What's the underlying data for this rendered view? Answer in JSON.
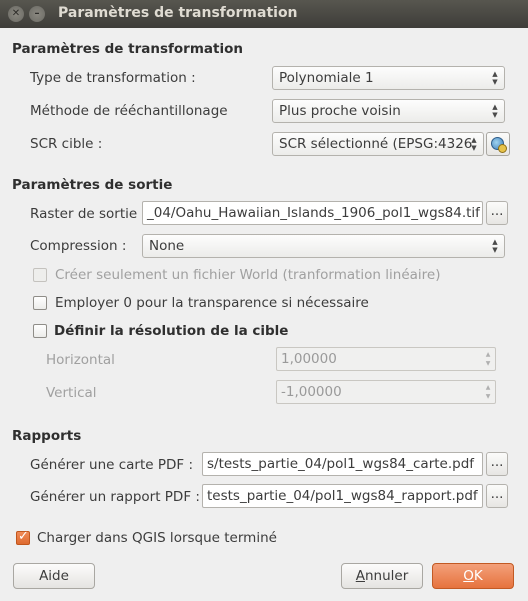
{
  "window": {
    "title": "Paramètres de transformation"
  },
  "transform_section": {
    "title": "Paramètres de transformation",
    "type_label": "Type de transformation :",
    "type_value": "Polynomiale 1",
    "resample_label": "Méthode de rééchantillonage",
    "resample_value": "Plus proche voisin",
    "crs_label": "SCR cible :",
    "crs_value": "SCR sélectionné (EPSG:4326"
  },
  "output_section": {
    "title": "Paramètres de sortie",
    "raster_label": "Raster de sortie",
    "raster_value": "_04/Oahu_Hawaiian_Islands_1906_pol1_wgs84.tif",
    "browse_label": "...",
    "compression_label": "Compression :",
    "compression_value": "None",
    "world_file_label": "Créer seulement un fichier World (tranformation linéaire)",
    "world_file_checked": false,
    "transparency_label": "Employer 0 pour la transparence si nécessaire",
    "transparency_checked": false,
    "resolution_label": "Définir la résolution de la cible",
    "resolution_checked": false,
    "horizontal_label": "Horizontal",
    "horizontal_value": "1,00000",
    "vertical_label": "Vertical",
    "vertical_value": "-1,00000"
  },
  "reports_section": {
    "title": "Rapports",
    "map_label": "Générer une carte PDF :",
    "map_value": "s/tests_partie_04/pol1_wgs84_carte.pdf",
    "report_label": "Générer un rapport PDF :",
    "report_value": "tests_partie_04/pol1_wgs84_rapport.pdf",
    "browse_label": "..."
  },
  "load_in_qgis": {
    "label": "Charger dans QGIS lorsque terminé",
    "checked": true
  },
  "buttons": {
    "help": "Aide",
    "cancel": "Annuler",
    "ok": "OK"
  },
  "titlebar_icons": {
    "close": "close-icon",
    "minimize": "minimize-icon"
  },
  "colors": {
    "accent": "#e6733e",
    "titlebar": "#3e3d39"
  }
}
